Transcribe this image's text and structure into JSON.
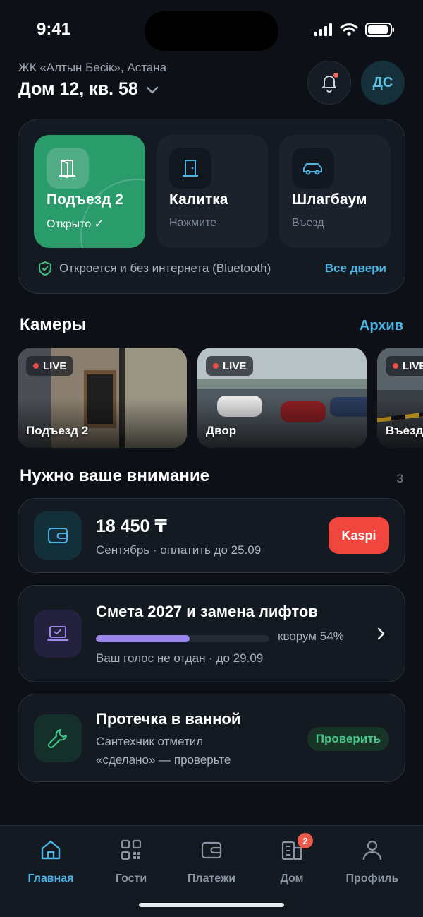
{
  "status": {
    "time": "9:41"
  },
  "header": {
    "complex": "ЖК «Алтын Бесік», Астана",
    "apartment": "Дом 12, кв. 58",
    "avatar_initials": "ДС"
  },
  "doors": [
    {
      "title": "Подъезд 2",
      "subtitle": "Открыто ✓",
      "state": "open",
      "icon": "door-open-icon"
    },
    {
      "title": "Калитка",
      "subtitle": "Нажмите",
      "state": "closed",
      "icon": "gate-icon"
    },
    {
      "title": "Шлагбаум",
      "subtitle": "Въезд",
      "state": "closed",
      "icon": "car-icon"
    }
  ],
  "doors_footer": {
    "offline_text": "Откроется и без интернета (Bluetooth)",
    "all_doors": "Все двери"
  },
  "cameras": {
    "title": "Камеры",
    "archive_link": "Архив",
    "items": [
      {
        "label": "Подъезд 2",
        "badge": "LIVE"
      },
      {
        "label": "Двор",
        "badge": "LIVE"
      },
      {
        "label": "Въезд",
        "badge": "LIVE"
      }
    ]
  },
  "attention": {
    "title": "Нужно ваше внимание",
    "count": "3",
    "payment": {
      "amount": "18 450 ₸",
      "subtitle": "Сентябрь · оплатить до 25.09",
      "button": "Kaspi"
    },
    "vote": {
      "title": "Смета 2027 и замена лифтов",
      "quorum_label": "кворум 54%",
      "quorum": 0.54,
      "subtitle": "Ваш голос не отдан · до 29.09"
    },
    "repair": {
      "title": "Протечка в ванной",
      "subtitle_line1": "Сантехник отметил",
      "subtitle_line2": "«сделано» — проверьте",
      "button": "Проверить"
    }
  },
  "tabs": [
    {
      "label": "Главная",
      "icon": "home-icon",
      "active": true
    },
    {
      "label": "Гости",
      "icon": "qr-code-icon",
      "active": false
    },
    {
      "label": "Платежи",
      "icon": "wallet-icon",
      "active": false
    },
    {
      "label": "Дом",
      "icon": "building-icon",
      "active": false,
      "badge": "2"
    },
    {
      "label": "Профиль",
      "icon": "profile-icon",
      "active": false
    }
  ],
  "colors": {
    "accent": "#4db3e3",
    "open_green": "#2a9c6b",
    "danger": "#f0463d",
    "vote_purple": "#9b86ee"
  }
}
